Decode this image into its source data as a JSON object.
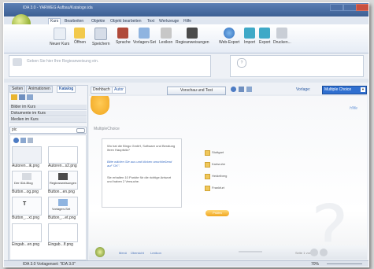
{
  "window": {
    "title": "IDA 3.0 - YARWEG Aufbau/Kataloge.ida"
  },
  "ribbon": {
    "tabs": [
      "Kurs",
      "Bearbeiten",
      "Objekte",
      "Objekt bearbeiten",
      "Text",
      "Werkzeuge",
      "Hilfe"
    ],
    "active_tab": "Kurs",
    "buttons": [
      "Neuer Kurs",
      "Öffnen",
      "Speichern",
      "Sprache",
      "Vorlagen-Set",
      "Lexikon",
      "Regieanweisungen",
      "Web-Export",
      "Import",
      "Export",
      "Drucken..."
    ]
  },
  "regie": {
    "placeholder": "Geben Sie hier Ihre Regieanweisung ein."
  },
  "leftpane": {
    "tabs": [
      "Seiten",
      "Animationen",
      "Katalog"
    ],
    "active_tab": "Katalog",
    "sections": [
      "Bilder im Kurs",
      "Dokumente im Kurs",
      "Medien im Kurs"
    ],
    "search_value": "pic",
    "items": [
      {
        "label": "Autoren...ik.png",
        "caption": ""
      },
      {
        "label": "Autoren...s2.png",
        "caption": ""
      },
      {
        "label": "Button...og.png",
        "caption": "Der IDA-Blog"
      },
      {
        "label": "Button...en.png",
        "caption": "Regieanweisungen"
      },
      {
        "label": "Button_...xt.png",
        "caption": "T"
      },
      {
        "label": "Button_...et.png",
        "caption": "Vorlagen-Set"
      },
      {
        "label": "Eingab...en.png",
        "caption": ""
      },
      {
        "label": "Eingab...lf.png",
        "caption": ""
      }
    ]
  },
  "center": {
    "tabs": [
      "Drehbuch",
      "Autor"
    ],
    "active_tab": "Autor",
    "preview_button": "Vorschau und Test",
    "vorlage_label": "Vorlage:",
    "vorlage_value": "Multiple Choice"
  },
  "slide": {
    "hilfe": "Hilfe",
    "heading": "MultipleChoice",
    "question_lines": [
      "Wo hat die Bingo GmbH, Software und Beratung ihren Hauptsitz?",
      "Bitte wählen Sie aus und klicken anschließend auf \"OK\".",
      "Sie erhalten 10 Punkte für die richtige Antwort und haben 2 Versuche."
    ],
    "options": [
      "Stuttgart",
      "Karlsruhe",
      "Heidelberg",
      "Frankfurt"
    ],
    "ok_button": "Prüfen",
    "nav": [
      "Menü",
      "Übersicht",
      "Lexikon"
    ],
    "page_indicator": "Seite 1 von 1"
  },
  "status": {
    "left": "IDA 3.0  Vorlagenset: \"IDA 3.0\"",
    "zoom": "70%"
  },
  "colors": {
    "accent": "#2f6fd0",
    "option_box": "#f0c75a",
    "title_bar": "#3c5f93"
  }
}
